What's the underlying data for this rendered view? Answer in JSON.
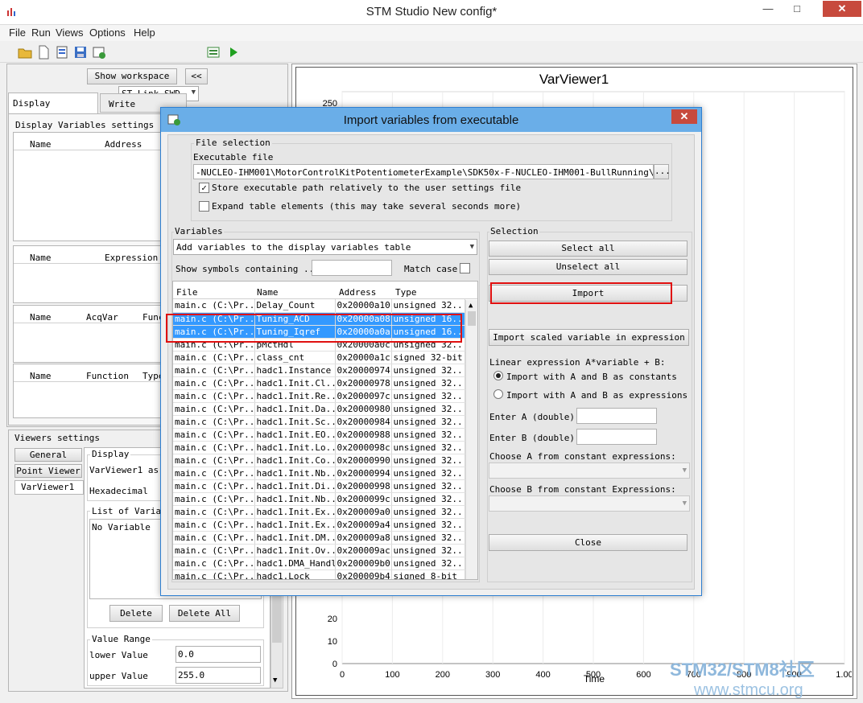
{
  "window": {
    "title": "STM Studio New config*",
    "minimize": "—",
    "maximize": "□",
    "close": "✕"
  },
  "menu": [
    "File",
    "Run",
    "Views",
    "Options",
    "Help"
  ],
  "toolbar": {
    "probe": "ST-Link SWD"
  },
  "left": {
    "show_workspace": "Show workspace",
    "collapse": "<<",
    "tabs": [
      "Display Variables",
      "Write Variables"
    ],
    "settings_title": "Display Variables settings",
    "t1": [
      "Name",
      "Address"
    ],
    "t2": [
      "Name",
      "Expression"
    ],
    "t3": [
      "Name",
      "AcqVar",
      "Func"
    ],
    "t4": [
      "Name",
      "Function",
      "Type"
    ],
    "viewers_title": "Viewers settings",
    "viewer_tabs": [
      "General",
      "Point Viewer",
      "VarViewer1"
    ],
    "display_title": "Display",
    "display_line1": "VarViewer1 as",
    "display_line2": "Hexadecimal",
    "list_title": "List of Variab",
    "no_variable": "No Variable",
    "delete": "Delete",
    "delete_all": "Delete All",
    "range_title": "Value Range",
    "lower_label": "lower Value",
    "lower_value": "0.0",
    "upper_label": "upper Value",
    "upper_value": "255.0"
  },
  "chart_data": {
    "type": "line",
    "title": "VarViewer1",
    "xlabel": "Time",
    "ylabel": "",
    "xlim": [
      0,
      1000
    ],
    "ylim": [
      0,
      250
    ],
    "x_ticks": [
      "0",
      "100",
      "200",
      "300",
      "400",
      "500",
      "600",
      "700",
      "800",
      "900",
      "1.00"
    ],
    "y_ticks_visible": [
      "250",
      "20",
      "10",
      "0"
    ],
    "grid": true,
    "series": []
  },
  "dialog": {
    "title": "Import variables from executable",
    "close": "✕",
    "file_selection": "File selection",
    "exec_label": "Executable file",
    "exec_path": "-NUCLEO-IHM001\\MotorControlKitPotentiometerExample\\SDK50x-F-NUCLEO-IHM001-BullRunning\\EWARM\\SI",
    "browse": "...",
    "store_relative": "Store executable path relatively to the user settings file",
    "expand_table": "Expand table elements (this may take several seconds more)",
    "variables_title": "Variables",
    "add_option": "Add variables to the display variables table",
    "show_symbols": "Show symbols containing ...",
    "match_case": "Match case",
    "columns": [
      "File",
      "Name",
      "Address",
      "Type"
    ],
    "rows": [
      [
        "main.c (C:\\Pr...",
        "Delay_Count",
        "0x20000a10",
        "unsigned 32..."
      ],
      [
        "main.c (C:\\Pr...",
        "Tuning_ACD",
        "0x20000a08",
        "unsigned 16..."
      ],
      [
        "main.c (C:\\Pr...",
        "Tuning_Iqref",
        "0x20000a0a",
        "unsigned 16..."
      ],
      [
        "main.c (C:\\Pr...",
        "pMctHdl",
        "0x20000a0c",
        "unsigned 32..."
      ],
      [
        "main.c (C:\\Pr...",
        "class_cnt",
        "0x20000a1c",
        "signed 32-bit"
      ],
      [
        "main.c (C:\\Pr...",
        "hadc1.Instance",
        "0x20000974",
        "unsigned 32..."
      ],
      [
        "main.c (C:\\Pr...",
        "hadc1.Init.Cl...",
        "0x20000978",
        "unsigned 32..."
      ],
      [
        "main.c (C:\\Pr...",
        "hadc1.Init.Re...",
        "0x2000097c",
        "unsigned 32..."
      ],
      [
        "main.c (C:\\Pr...",
        "hadc1.Init.Da...",
        "0x20000980",
        "unsigned 32..."
      ],
      [
        "main.c (C:\\Pr...",
        "hadc1.Init.Sc...",
        "0x20000984",
        "unsigned 32..."
      ],
      [
        "main.c (C:\\Pr...",
        "hadc1.Init.EO...",
        "0x20000988",
        "unsigned 32..."
      ],
      [
        "main.c (C:\\Pr...",
        "hadc1.Init.Lo...",
        "0x2000098c",
        "unsigned 32..."
      ],
      [
        "main.c (C:\\Pr...",
        "hadc1.Init.Co...",
        "0x20000990",
        "unsigned 32..."
      ],
      [
        "main.c (C:\\Pr...",
        "hadc1.Init.Nb...",
        "0x20000994",
        "unsigned 32..."
      ],
      [
        "main.c (C:\\Pr...",
        "hadc1.Init.Di...",
        "0x20000998",
        "unsigned 32..."
      ],
      [
        "main.c (C:\\Pr...",
        "hadc1.Init.Nb...",
        "0x2000099c",
        "unsigned 32..."
      ],
      [
        "main.c (C:\\Pr...",
        "hadc1.Init.Ex...",
        "0x200009a0",
        "unsigned 32..."
      ],
      [
        "main.c (C:\\Pr...",
        "hadc1.Init.Ex...",
        "0x200009a4",
        "unsigned 32..."
      ],
      [
        "main.c (C:\\Pr...",
        "hadc1.Init.DM...",
        "0x200009a8",
        "unsigned 32..."
      ],
      [
        "main.c (C:\\Pr...",
        "hadc1.Init.Ov...",
        "0x200009ac",
        "unsigned 32..."
      ],
      [
        "main.c (C:\\Pr...",
        "hadc1.DMA_Handle",
        "0x200009b0",
        "unsigned 32..."
      ],
      [
        "main.c (C:\\Pr...",
        "hadc1.Lock",
        "0x200009b4",
        "signed 8-bit"
      ]
    ],
    "selected_rows": [
      1,
      2
    ],
    "selection_title": "Selection",
    "select_all": "Select all",
    "unselect_all": "Unselect all",
    "import": "Import",
    "import_scaled": "Import scaled variable in expression",
    "linear_expr": "Linear expression A*variable + B:",
    "radio_constants": "Import with A and B as constants",
    "radio_expressions": "Import with A and B as expressions",
    "enter_a": "Enter A (double):",
    "enter_b": "Enter B (double):",
    "choose_a": "Choose A from constant expressions:",
    "choose_b": "Choose B from constant Expressions:",
    "close_btn": "Close"
  },
  "watermark": {
    "line1": "STM32/STM8社区",
    "line2": "www.stmcu.org"
  },
  "colors": {
    "selection": "#3399ff",
    "highlight_box": "#e01010",
    "dialog_title": "#6aaee8"
  }
}
